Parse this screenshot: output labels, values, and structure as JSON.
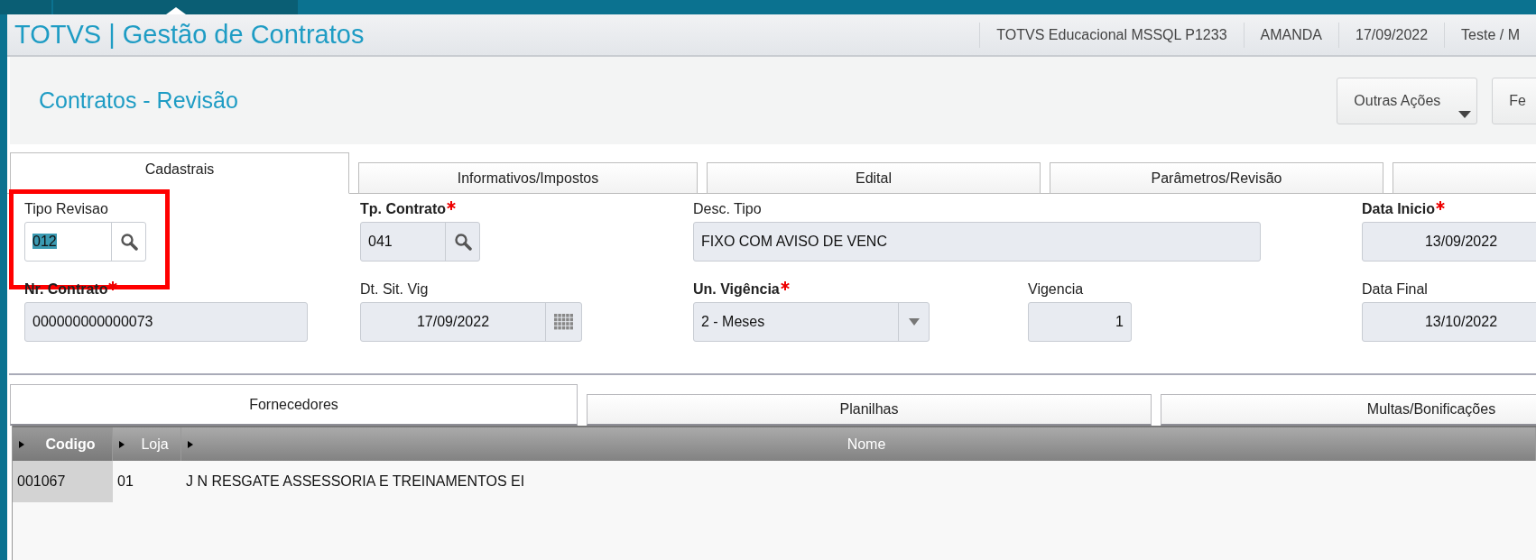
{
  "app_bar": {
    "title": "TOTVS | Gestão de Contratos",
    "info": [
      "TOTVS Educacional MSSQL P1233",
      "AMANDA",
      "17/09/2022",
      "Teste / M"
    ]
  },
  "header": {
    "title": "Contratos - Revisão",
    "buttons": [
      {
        "label": "Outras Ações",
        "kind": "menu"
      },
      {
        "label": "Fe",
        "kind": "plain"
      }
    ]
  },
  "tabs": [
    {
      "label": "Cadastrais",
      "selected": true
    },
    {
      "label": "Informativos/Impostos",
      "selected": false
    },
    {
      "label": "Edital",
      "selected": false
    },
    {
      "label": "Parâmetros/Revisão",
      "selected": false
    },
    {
      "selected": false
    }
  ],
  "form_rows": [
    [
      {
        "label": "Tipo Revisao",
        "required": false,
        "kind": "lookup",
        "value": "012",
        "disabled": false,
        "highlighted": true
      },
      {
        "label": "Tp. Contrato",
        "required": true,
        "kind": "lookup",
        "value": "041",
        "disabled": true,
        "highlighted": false
      },
      {
        "label": "Desc. Tipo",
        "required": false,
        "kind": "text",
        "value": "FIXO COM AVISO DE VENC",
        "disabled": true,
        "highlighted": false
      },
      {
        "label": "Data Inicio",
        "required": true,
        "kind": "date",
        "value": "13/09/2022",
        "disabled": true,
        "highlighted": false
      }
    ],
    [
      {
        "label": "Nr. Contrato",
        "required": true,
        "kind": "text",
        "value": "000000000000073",
        "disabled": true,
        "highlighted": false
      },
      {
        "label": "Dt. Sit. Vig",
        "required": false,
        "kind": "date_picker",
        "value": "17/09/2022",
        "disabled": true,
        "highlighted": false
      },
      {
        "label": "Un. Vigência",
        "required": true,
        "kind": "select",
        "value": "2 - Meses",
        "disabled": true,
        "highlighted": false
      },
      {
        "label": "Vigencia",
        "required": false,
        "kind": "number",
        "value": "1",
        "disabled": true,
        "highlighted": false
      },
      {
        "label": "Data Final",
        "required": false,
        "kind": "date",
        "value": "13/10/2022",
        "disabled": true,
        "highlighted": false
      }
    ]
  ],
  "sub_tabs": [
    {
      "label": "Fornecedores",
      "selected": true
    },
    {
      "label": "Planilhas",
      "selected": false
    },
    {
      "label": "Multas/Bonificações",
      "selected": false
    }
  ],
  "table": {
    "columns": [
      {
        "label": "Codigo",
        "sorted": true
      },
      {
        "label": "Loja",
        "sorted": false
      },
      {
        "label": "Nome",
        "sorted": false
      }
    ],
    "rows": [
      {
        "cells": [
          "001067",
          "01",
          "J N RESGATE ASSESSORIA E TREINAMENTOS EI"
        ],
        "selected": true
      }
    ]
  }
}
